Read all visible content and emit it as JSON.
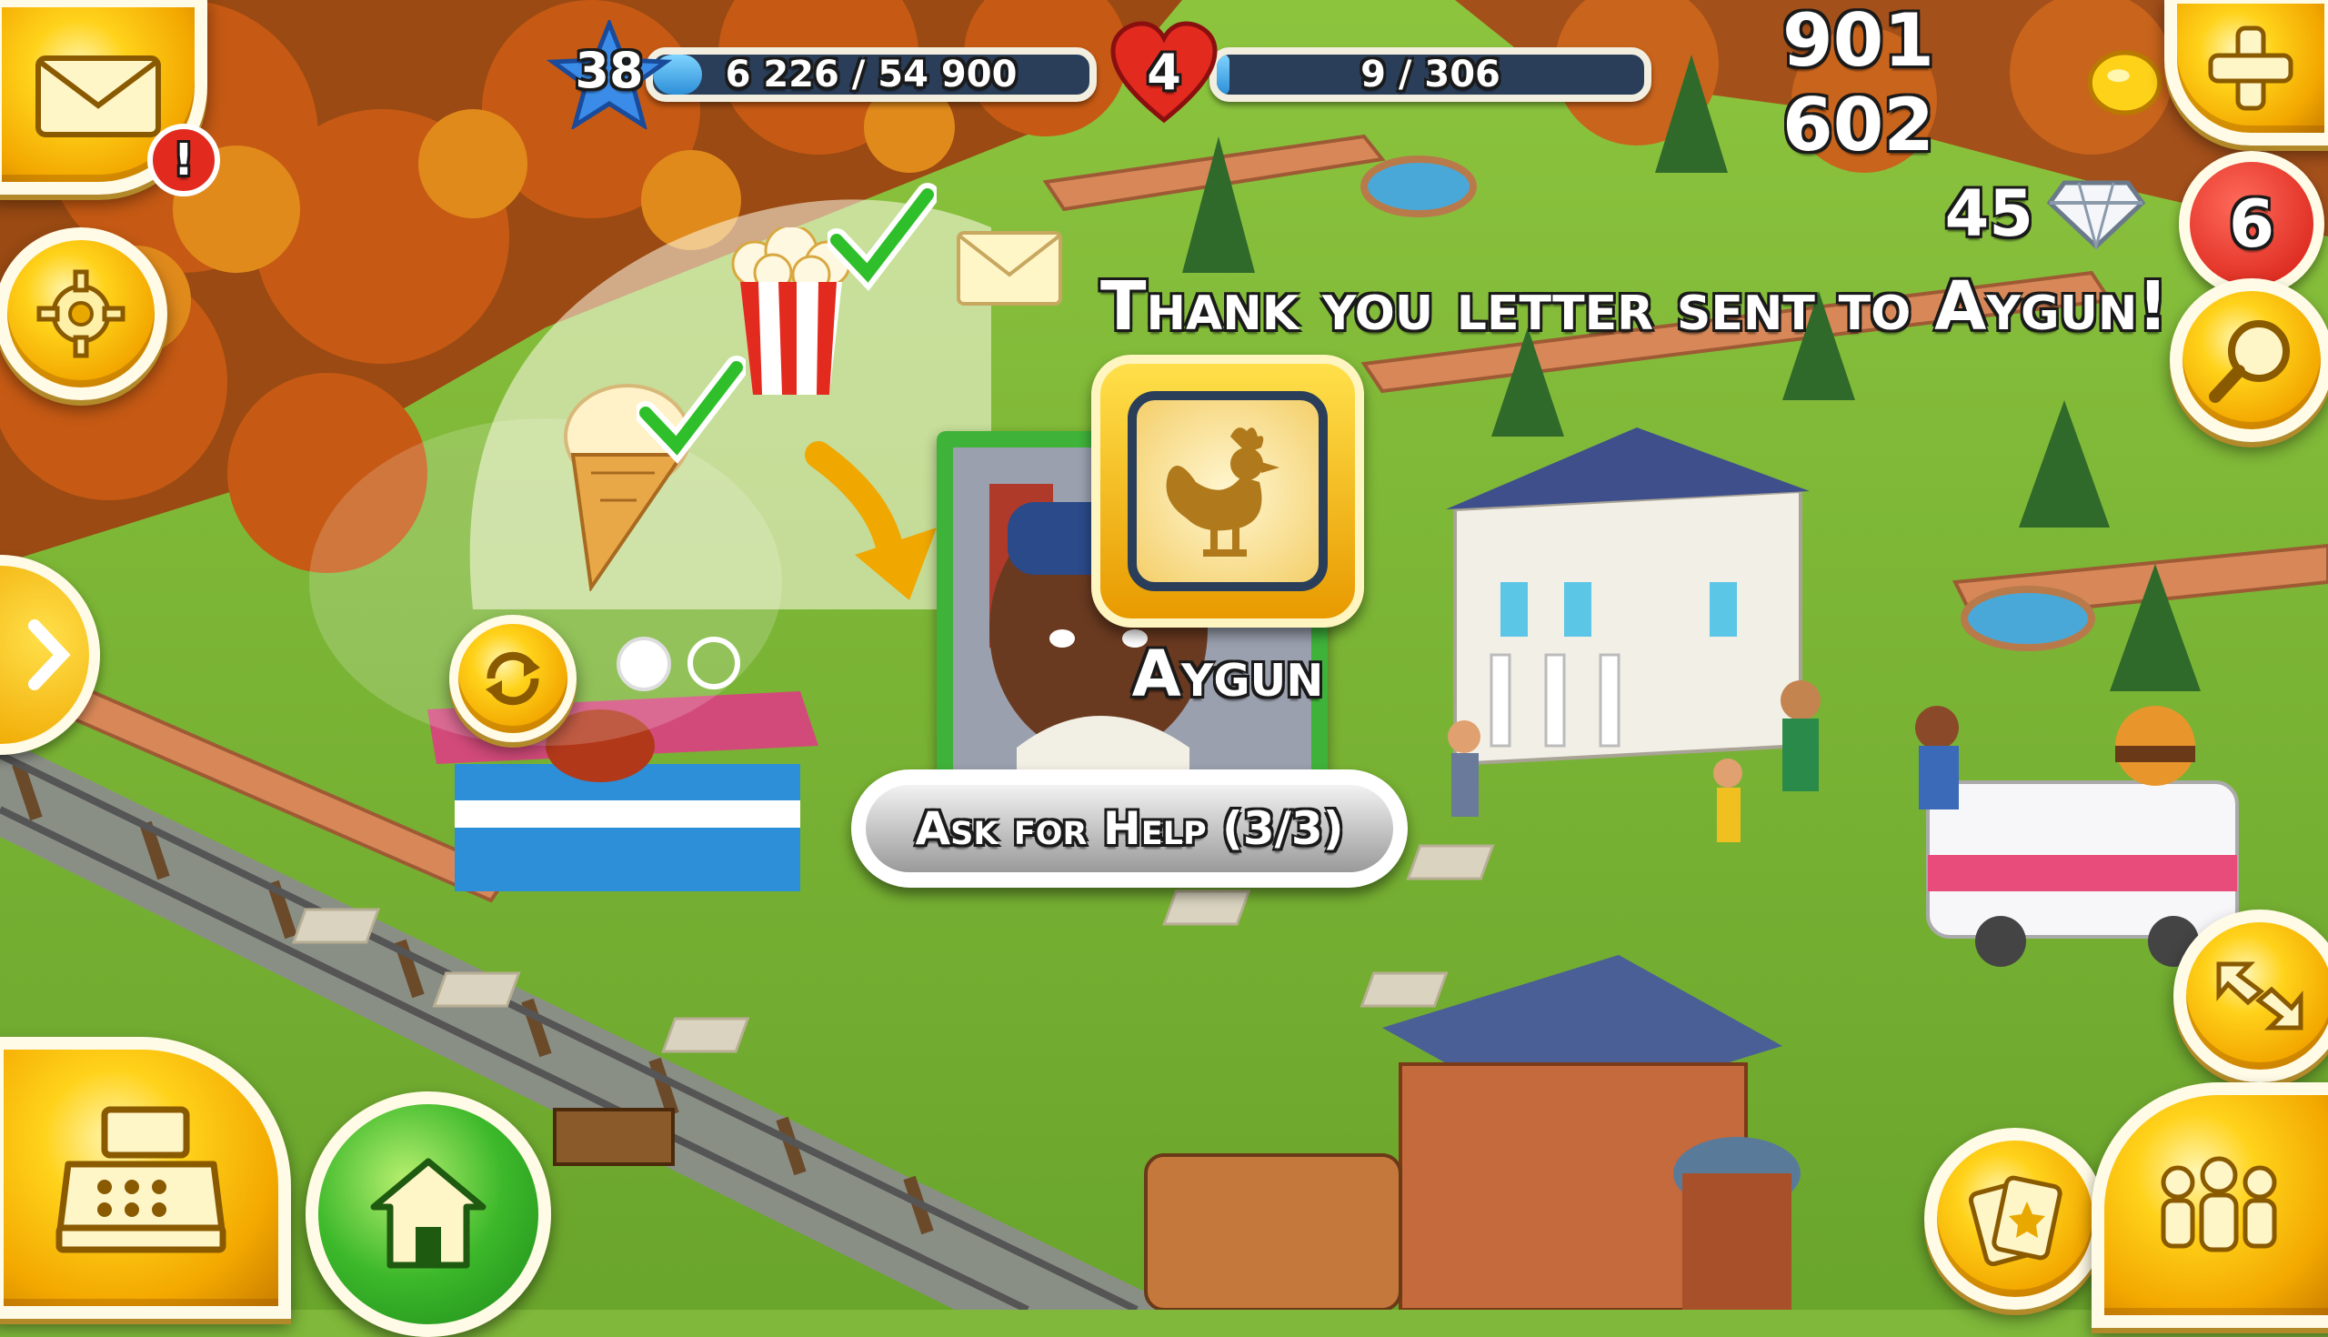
{
  "hud": {
    "level": "38",
    "xp_text": "6 226 / 54 900",
    "xp_progress": 0.113,
    "reputation_level": "4",
    "reputation_text": "9 / 306",
    "reputation_progress": 0.03,
    "coins": "901 602",
    "diamonds": "45",
    "notification_count": "6",
    "mail_alert": "!"
  },
  "toast": {
    "message": "Thank you letter sent to Aygun!"
  },
  "visitor_panel": {
    "name": "Aygun",
    "ask_help_label": "Ask for Help (3/3)",
    "badge_icon": "rooster-icon"
  },
  "colors": {
    "gold": "#ffd21a",
    "bar_fill": "#2d8fd8",
    "heart_red": "#e22a1e",
    "grass": "#7fb83a",
    "check_green": "#2fbf2a"
  },
  "icons": {
    "mail": "envelope-icon",
    "settings": "gear-icon",
    "add": "plus-icon",
    "search": "magnifier-icon",
    "expand": "chevron-right-icon",
    "refresh": "refresh-icon",
    "shop": "cash-register-icon",
    "home": "house-icon",
    "map": "expand-arrows-icon",
    "cards": "cards-icon",
    "friends": "friends-icon"
  }
}
